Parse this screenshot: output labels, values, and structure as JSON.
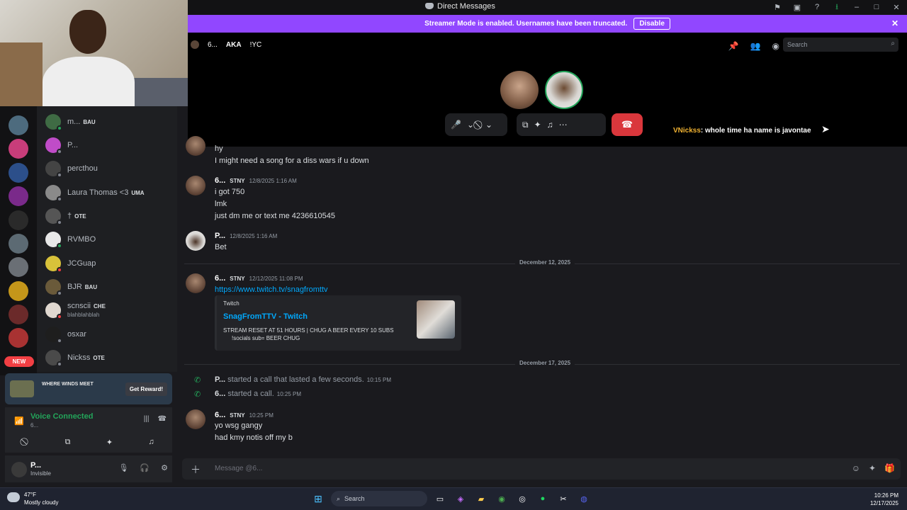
{
  "window": {
    "title": "Direct Messages"
  },
  "banner": {
    "text": "Streamer Mode is enabled. Usernames have been truncated.",
    "disable_label": "Disable"
  },
  "channel": {
    "name": "6...",
    "aka_label": "AKA",
    "aka_value": "!YC",
    "search_placeholder": "Search"
  },
  "dm_list": [
    {
      "name": "m...",
      "tag": "BAU",
      "status": "online"
    },
    {
      "name": "P...",
      "tag": "",
      "status": "offline"
    },
    {
      "name": "percthou",
      "tag": "",
      "status": "offline"
    },
    {
      "name": "Laura Thomas <3",
      "tag": "UMA",
      "status": "offline"
    },
    {
      "name": "†",
      "tag": "OTE",
      "status": "offline"
    },
    {
      "name": "RVMBO",
      "tag": "",
      "status": "online"
    },
    {
      "name": "JCGuap",
      "tag": "",
      "status": "dnd"
    },
    {
      "name": "BJR",
      "tag": "BAU",
      "status": "offline"
    },
    {
      "name": "scnscii",
      "tag": "CHE",
      "sub": "blahblahblah",
      "status": "dnd"
    },
    {
      "name": "osxar",
      "tag": "",
      "status": "offline"
    },
    {
      "name": "Nickss",
      "tag": "OTE",
      "status": "offline"
    }
  ],
  "new_badge": "NEW",
  "activity": {
    "game": "WHERE WINDS MEET",
    "reward_label": "Get Reward!"
  },
  "voice": {
    "status": "Voice Connected",
    "channel": "6..."
  },
  "user": {
    "name": "P...",
    "status": "Invisible"
  },
  "call_overlay": {
    "name": "VNickss",
    "text": ": whole time ha name is javontae"
  },
  "messages": {
    "top_lines": [
      "hy",
      "I might need a song for a diss wars if u down"
    ],
    "group1": {
      "author": "6...",
      "tag": "STNY",
      "time": "12/8/2025 1:16 AM",
      "lines": [
        "i got 750",
        "lmk",
        "just dm me or text me 4236610545"
      ]
    },
    "group2": {
      "author": "P...",
      "time": "12/8/2025 1:16 AM",
      "lines": [
        "Bet"
      ]
    },
    "divider1": "December 12, 2025",
    "group3": {
      "author": "6...",
      "tag": "STNY",
      "time": "12/12/2025 11:08 PM",
      "link": "https://www.twitch.tv/snagfromttv"
    },
    "embed": {
      "provider": "Twitch",
      "title": "SnagFromTTV - Twitch",
      "desc1": "STREAM RESET AT 51 HOURS | CHUG A BEER EVERY 10 SUBS",
      "desc2": "!socials sub= BEER CHUG"
    },
    "divider2": "December 17, 2025",
    "call1": {
      "author": "P...",
      "text": "started a call that lasted a few seconds.",
      "time": "10:15 PM"
    },
    "call2": {
      "author": "6...",
      "text": "started a call.",
      "time": "10:25 PM"
    },
    "group4": {
      "author": "6...",
      "tag": "STNY",
      "time": "10:25 PM",
      "lines": [
        "yo wsg gangy",
        "had kmy notis off my b"
      ]
    }
  },
  "composer": {
    "placeholder": "Message @6..."
  },
  "taskbar": {
    "temp": "47°F",
    "weather": "Mostly cloudy",
    "search": "Search",
    "time": "10:26 PM",
    "date": "12/17/2025"
  },
  "colors": {
    "banner": "#9147ff",
    "end_call": "#da373c",
    "voice_green": "#23a55a",
    "link": "#00a8fc"
  }
}
